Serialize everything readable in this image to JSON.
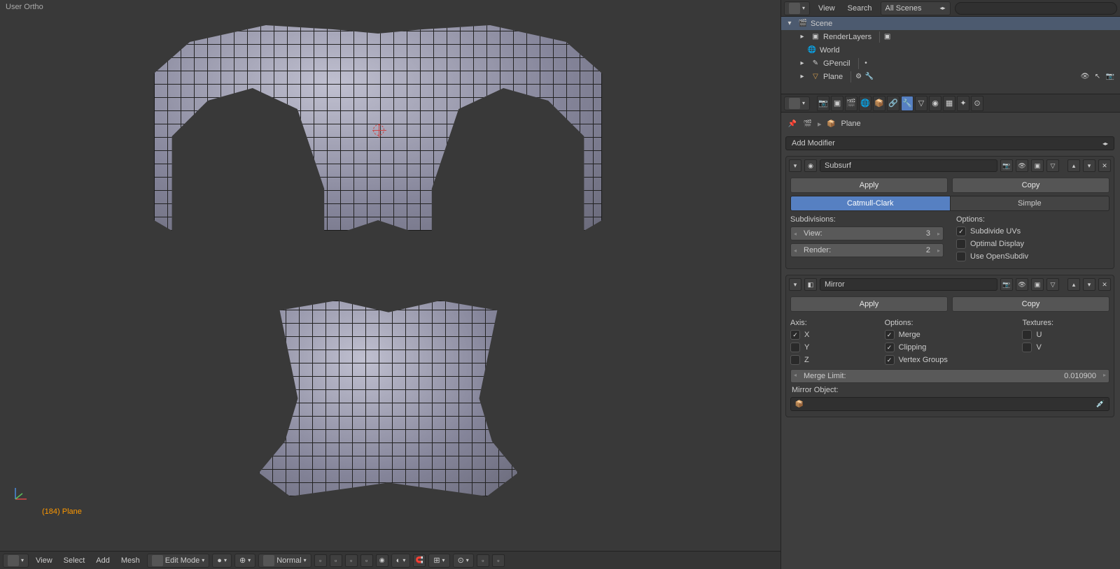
{
  "viewport": {
    "label": "User Ortho",
    "object_info": "(184) Plane"
  },
  "viewport_header": {
    "view": "View",
    "select": "Select",
    "add": "Add",
    "mesh": "Mesh",
    "mode": "Edit Mode",
    "shading": "Normal"
  },
  "outliner": {
    "view": "View",
    "search": "Search",
    "filter": "All Scenes",
    "tree": {
      "scene": "Scene",
      "renderlayers": "RenderLayers",
      "world": "World",
      "gpencil": "GPencil",
      "plane": "Plane"
    }
  },
  "properties": {
    "breadcrumb_obj": "Plane",
    "add_modifier": "Add Modifier",
    "subsurf": {
      "name": "Subsurf",
      "apply": "Apply",
      "copy": "Copy",
      "catmull": "Catmull-Clark",
      "simple": "Simple",
      "subdivisions_label": "Subdivisions:",
      "view_label": "View:",
      "view_val": "3",
      "render_label": "Render:",
      "render_val": "2",
      "options_label": "Options:",
      "sub_uvs": "Subdivide UVs",
      "optimal": "Optimal Display",
      "opensubdiv": "Use OpenSubdiv"
    },
    "mirror": {
      "name": "Mirror",
      "apply": "Apply",
      "copy": "Copy",
      "axis_label": "Axis:",
      "x": "X",
      "y": "Y",
      "z": "Z",
      "options_label": "Options:",
      "merge": "Merge",
      "clipping": "Clipping",
      "vgroups": "Vertex Groups",
      "textures_label": "Textures:",
      "u": "U",
      "v": "V",
      "merge_limit_label": "Merge Limit:",
      "merge_limit_val": "0.010900",
      "mirror_object_label": "Mirror Object:"
    }
  }
}
